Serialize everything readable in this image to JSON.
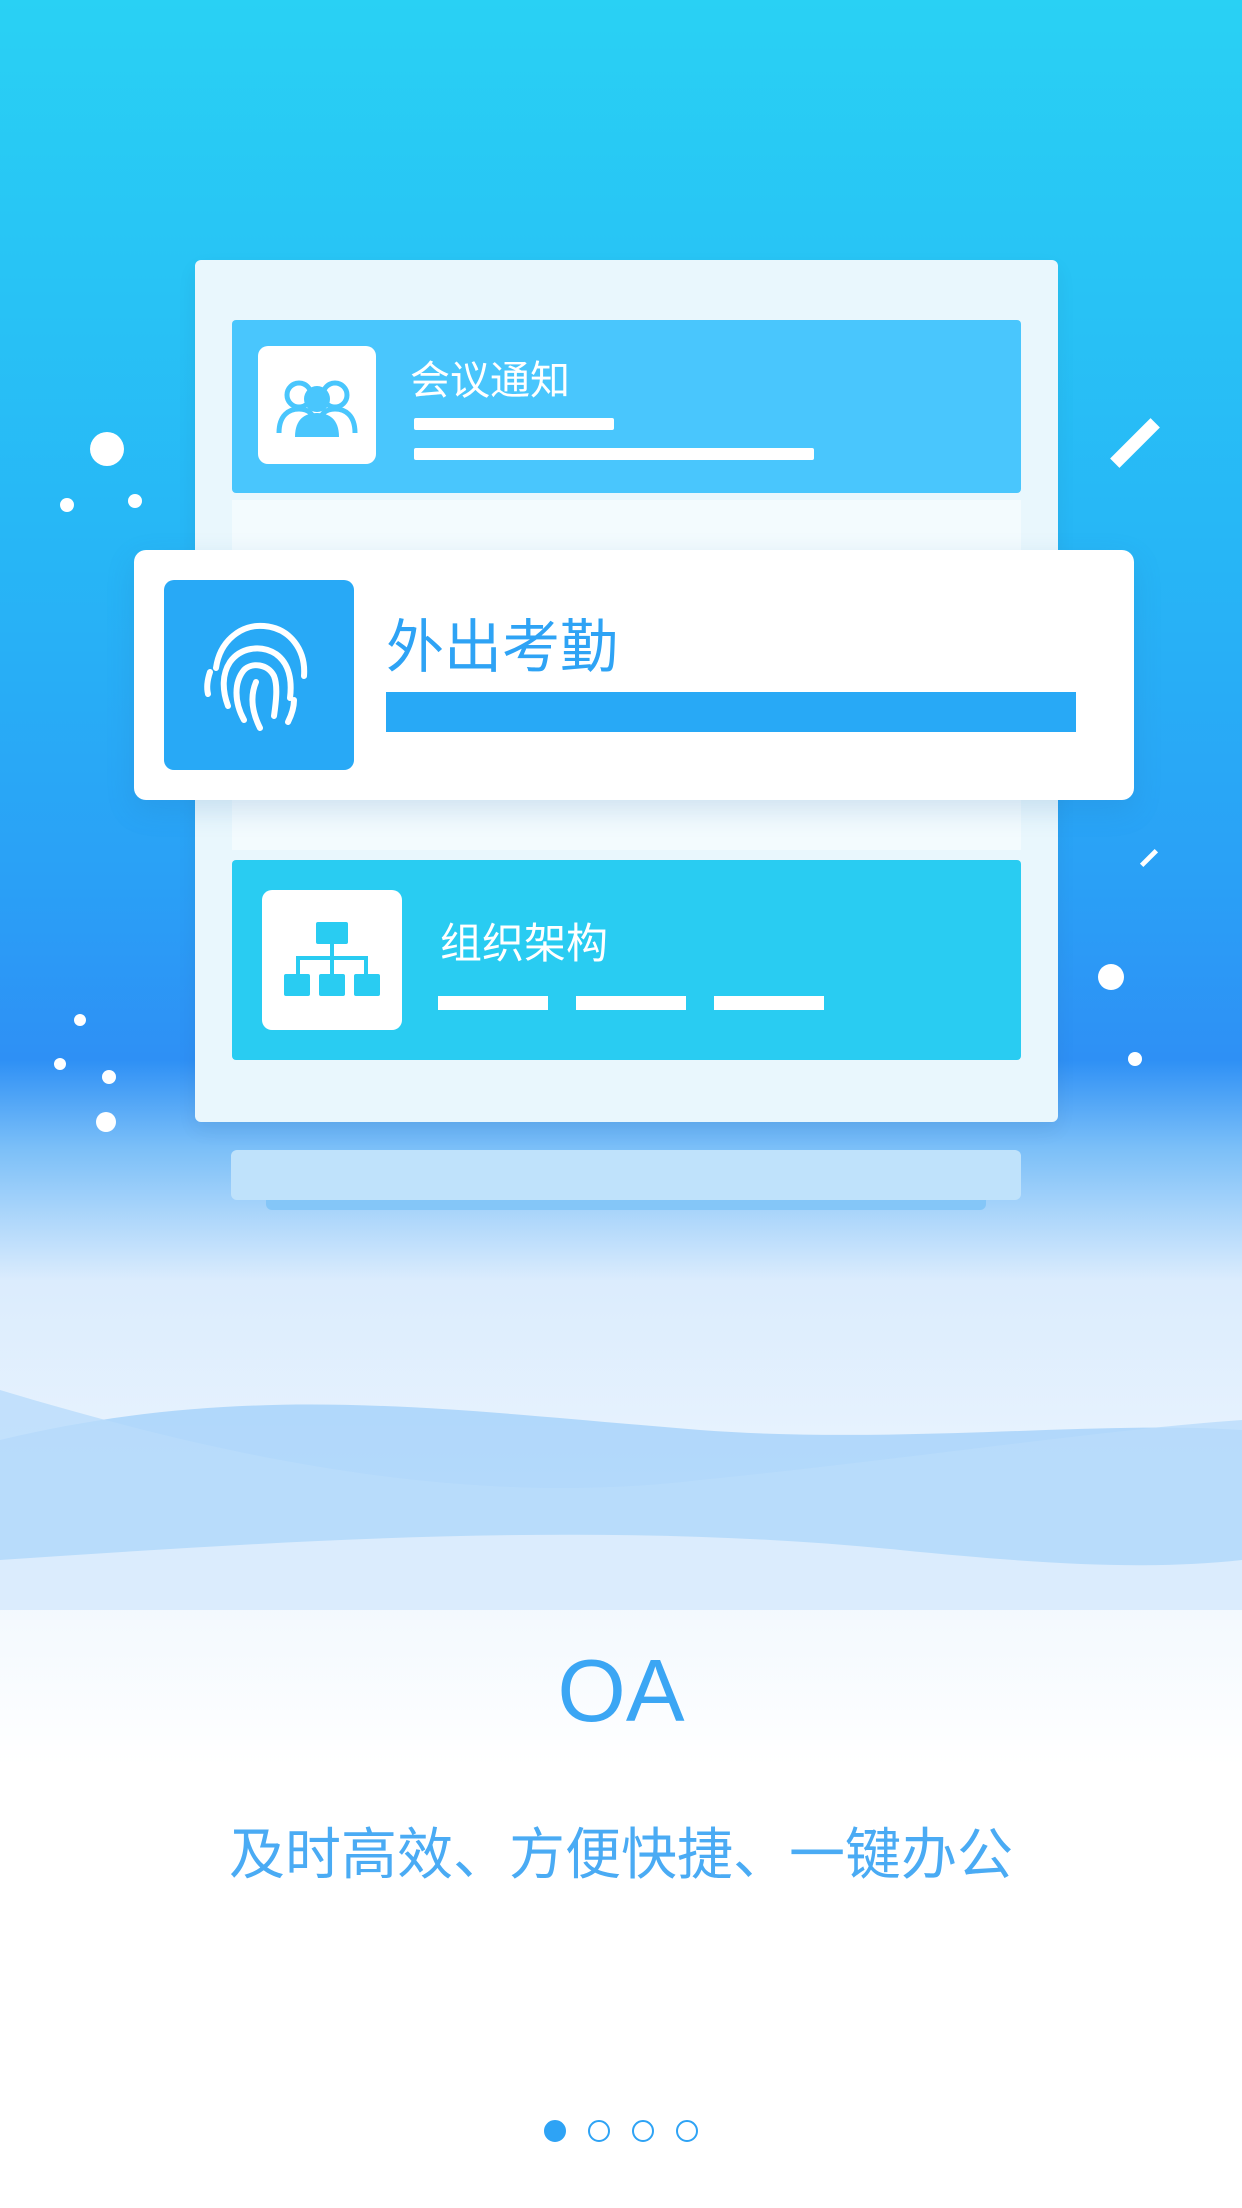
{
  "cards": {
    "meeting": {
      "title": "会议通知",
      "icon": "people-icon"
    },
    "attendance": {
      "title": "外出考勤",
      "icon": "fingerprint-icon"
    },
    "org": {
      "title": "组织架构",
      "icon": "org-chart-icon"
    }
  },
  "brand": "OA",
  "slogan": "及时高效、方便快捷、一键办公",
  "pagination": {
    "total": 4,
    "active_index": 0
  },
  "colors": {
    "accent": "#2ea3f5",
    "top_gradient": "#29d1f4",
    "card_blue": "#49c6fd",
    "card_cyan": "#29ccf2"
  }
}
